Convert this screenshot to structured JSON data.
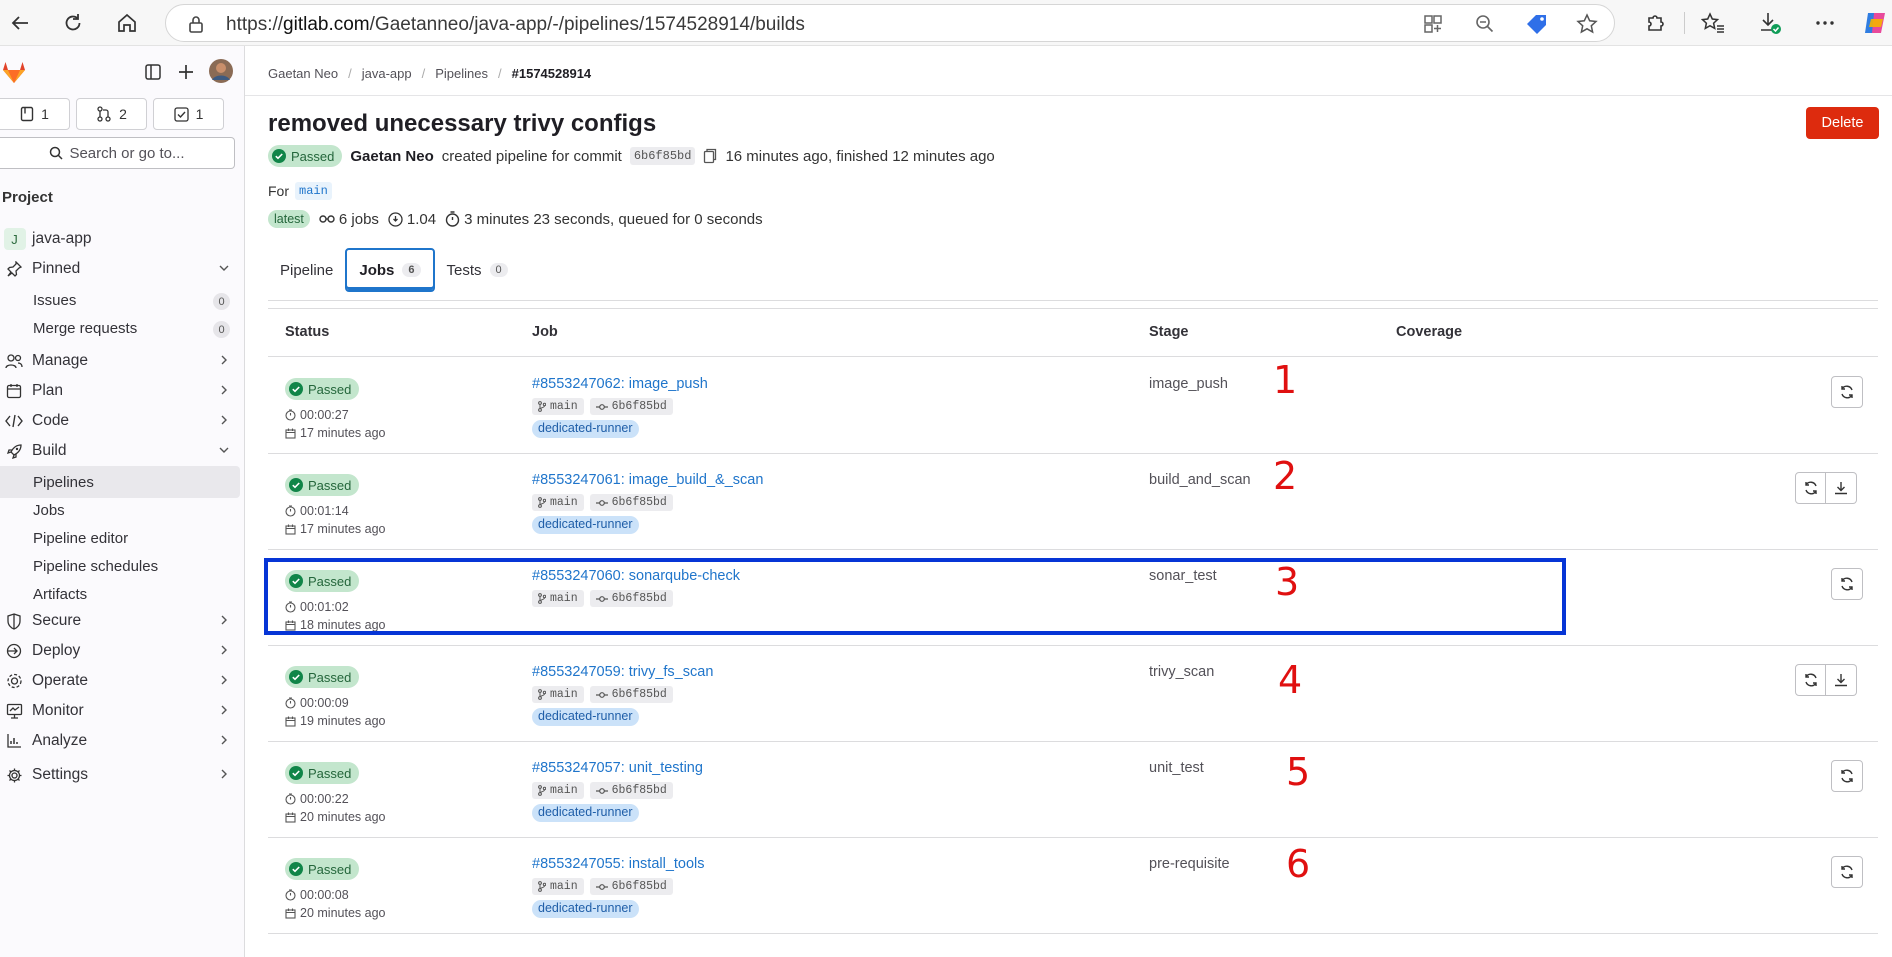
{
  "browser": {
    "url_prefix": "https://",
    "url_domain": "gitlab.com",
    "url_path": "/Gaetanneo/java-app/-/pipelines/1574528914/builds"
  },
  "sidebar": {
    "counts": [
      "1",
      "2",
      "1"
    ],
    "search": "Search or go to...",
    "heading": "Project",
    "project": {
      "tile": "J",
      "name": "java-app"
    },
    "pinned": "Pinned",
    "pinned_items": [
      {
        "label": "Issues",
        "count": "0"
      },
      {
        "label": "Merge requests",
        "count": "0"
      }
    ],
    "manage": "Manage",
    "plan": "Plan",
    "code": "Code",
    "build": "Build",
    "build_items": [
      "Pipelines",
      "Jobs",
      "Pipeline editor",
      "Pipeline schedules",
      "Artifacts"
    ],
    "secure": "Secure",
    "deploy": "Deploy",
    "operate": "Operate",
    "monitor": "Monitor",
    "analyze": "Analyze",
    "settings": "Settings"
  },
  "breadcrumb": [
    "Gaetan Neo",
    "java-app",
    "Pipelines",
    "#1574528914"
  ],
  "page": {
    "title": "removed unecessary trivy configs",
    "delete": "Delete",
    "status": "Passed",
    "user": "Gaetan Neo",
    "created_text": "created pipeline for commit",
    "commit": "6b6f85bd",
    "time_text": "16 minutes ago, finished 12 minutes ago",
    "for_label": "For",
    "branch": "main",
    "latest": "latest",
    "jobs_count": "6 jobs",
    "version": "1.04",
    "duration": "3 minutes 23 seconds, queued for 0 seconds"
  },
  "tabs": [
    {
      "label": "Pipeline",
      "count": ""
    },
    {
      "label": "Jobs",
      "count": "6"
    },
    {
      "label": "Tests",
      "count": "0"
    }
  ],
  "table": {
    "headers": [
      "Status",
      "Job",
      "Stage",
      "Coverage"
    ],
    "rows": [
      {
        "status": "Passed",
        "duration": "00:00:27",
        "ago": "17 minutes ago",
        "job": "#8553247062: image_push",
        "branch": "main",
        "sha": "6b6f85bd",
        "runner": "dedicated-runner",
        "stage": "image_push",
        "annot": "1"
      },
      {
        "status": "Passed",
        "duration": "00:01:14",
        "ago": "17 minutes ago",
        "job": "#8553247061: image_build_&_scan",
        "branch": "main",
        "sha": "6b6f85bd",
        "runner": "dedicated-runner",
        "stage": "build_and_scan",
        "annot": "2"
      },
      {
        "status": "Passed",
        "duration": "00:01:02",
        "ago": "18 minutes ago",
        "job": "#8553247060: sonarqube-check",
        "branch": "main",
        "sha": "6b6f85bd",
        "runner": "",
        "stage": "sonar_test",
        "annot": "3"
      },
      {
        "status": "Passed",
        "duration": "00:00:09",
        "ago": "19 minutes ago",
        "job": "#8553247059: trivy_fs_scan",
        "branch": "main",
        "sha": "6b6f85bd",
        "runner": "dedicated-runner",
        "stage": "trivy_scan",
        "annot": "4"
      },
      {
        "status": "Passed",
        "duration": "00:00:22",
        "ago": "20 minutes ago",
        "job": "#8553247057: unit_testing",
        "branch": "main",
        "sha": "6b6f85bd",
        "runner": "dedicated-runner",
        "stage": "unit_test",
        "annot": "5"
      },
      {
        "status": "Passed",
        "duration": "00:00:08",
        "ago": "20 minutes ago",
        "job": "#8553247055: install_tools",
        "branch": "main",
        "sha": "6b6f85bd",
        "runner": "dedicated-runner",
        "stage": "pre-requisite",
        "annot": "6"
      }
    ]
  },
  "colors": {
    "accent": "#1f75cb",
    "success": "#108548",
    "danger": "#dd2b0e",
    "annotation": "#e01010",
    "highlight": "#0635d6"
  }
}
